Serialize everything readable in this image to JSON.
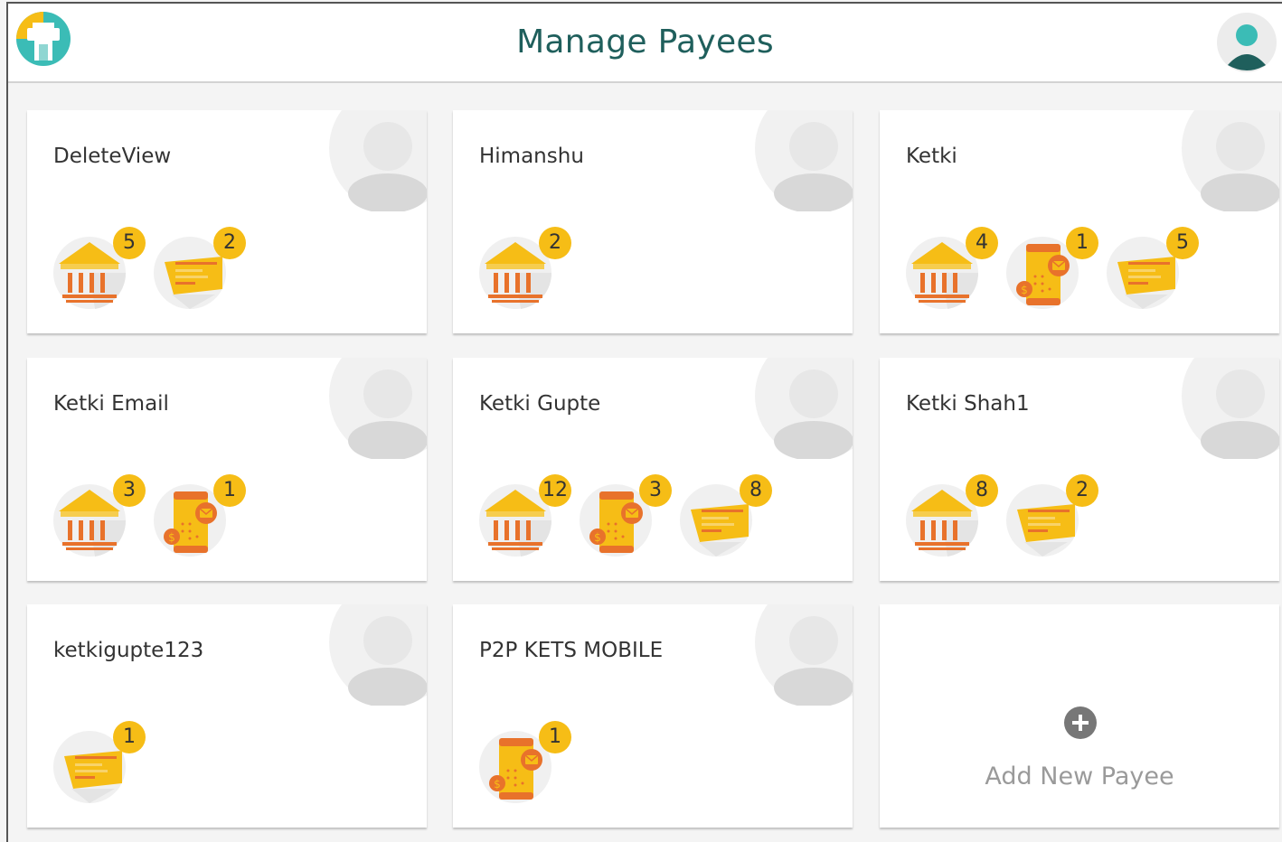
{
  "header": {
    "title": "Manage Payees"
  },
  "colors": {
    "accent_yellow": "#f6bd16",
    "accent_orange": "#e8722b",
    "title_teal": "#1f5f5c",
    "badge": "#f6bd16"
  },
  "payees": [
    {
      "name": "DeleteView",
      "methods": [
        {
          "type": "bank",
          "icon": "bank-icon",
          "count": "5"
        },
        {
          "type": "card",
          "icon": "card-icon",
          "count": "2"
        }
      ]
    },
    {
      "name": "Himanshu",
      "methods": [
        {
          "type": "bank",
          "icon": "bank-icon",
          "count": "2"
        }
      ]
    },
    {
      "name": "Ketki",
      "methods": [
        {
          "type": "bank",
          "icon": "bank-icon",
          "count": "4"
        },
        {
          "type": "mobile",
          "icon": "mobile-payment-icon",
          "count": "1"
        },
        {
          "type": "card",
          "icon": "card-icon",
          "count": "5"
        }
      ]
    },
    {
      "name": "Ketki Email",
      "methods": [
        {
          "type": "bank",
          "icon": "bank-icon",
          "count": "3"
        },
        {
          "type": "mobile",
          "icon": "mobile-payment-icon",
          "count": "1"
        }
      ]
    },
    {
      "name": "Ketki Gupte",
      "methods": [
        {
          "type": "bank",
          "icon": "bank-icon",
          "count": "12"
        },
        {
          "type": "mobile",
          "icon": "mobile-payment-icon",
          "count": "3"
        },
        {
          "type": "card",
          "icon": "card-icon",
          "count": "8"
        }
      ]
    },
    {
      "name": "Ketki Shah1",
      "methods": [
        {
          "type": "bank",
          "icon": "bank-icon",
          "count": "8"
        },
        {
          "type": "card",
          "icon": "card-icon",
          "count": "2"
        }
      ]
    },
    {
      "name": "ketkigupte123",
      "methods": [
        {
          "type": "card",
          "icon": "card-icon",
          "count": "1"
        }
      ]
    },
    {
      "name": "P2P KETS MOBILE",
      "methods": [
        {
          "type": "mobile",
          "icon": "mobile-payment-icon",
          "count": "1"
        }
      ]
    }
  ],
  "add_payee": {
    "label": "Add New Payee",
    "icon": "plus-circle-icon"
  }
}
